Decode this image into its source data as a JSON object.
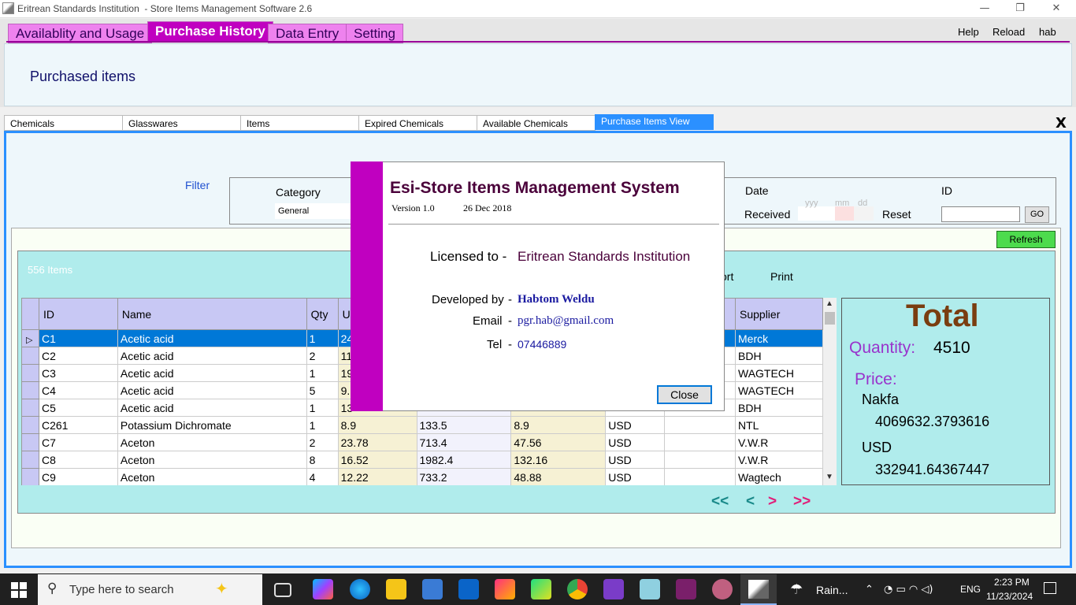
{
  "window": {
    "title": "Eritrean Standards Institution  - Store Items Management Software 2.6",
    "min": "—",
    "restore": "❐",
    "close": "✕"
  },
  "menu": {
    "tabs": [
      "Availablity and Usage",
      "Purchase History",
      "Data Entry",
      "Setting"
    ],
    "help": "Help",
    "reload": "Reload",
    "user": "hab"
  },
  "page_title": "Purchased items",
  "subtabs": [
    "Chemicals",
    "Glasswares",
    "Items",
    "Expired Chemicals",
    "Available Chemicals",
    "Purchase Items View"
  ],
  "close_x": "X",
  "filter": {
    "label": "Filter",
    "category_label": "Category",
    "category_value": "General",
    "date_label": "Date",
    "received_label": "Received",
    "date_hint_y": "yyy",
    "date_hint_m": "mm",
    "date_hint_d": "dd",
    "reset_label": "Reset",
    "id_label": "ID",
    "id_value": "",
    "go": "GO"
  },
  "refresh": "Refresh",
  "item_count": "556 Items",
  "report": "ort",
  "print": "Print",
  "grid": {
    "columns": [
      "ID",
      "Name",
      "Qty",
      "U",
      "",
      "",
      "",
      "",
      "Supplier"
    ],
    "rows": [
      [
        "C1",
        "Acetic acid",
        "1",
        "24",
        "",
        "",
        "",
        "",
        "Merck"
      ],
      [
        "C2",
        "Acetic acid",
        "2",
        "11",
        "",
        "",
        "",
        "",
        "BDH"
      ],
      [
        "C3",
        "Acetic acid",
        "1",
        "19",
        "",
        "",
        "",
        "",
        "WAGTECH"
      ],
      [
        "C4",
        "Acetic acid",
        "5",
        "9.",
        "",
        "",
        "",
        "",
        "WAGTECH"
      ],
      [
        "C5",
        "Acetic acid",
        "1",
        "13",
        "",
        "",
        "",
        "",
        "BDH"
      ],
      [
        "C261",
        "Potassium Dichromate",
        "1",
        "8.9",
        "133.5",
        "8.9",
        "USD",
        "",
        "NTL"
      ],
      [
        "C7",
        "Aceton",
        "2",
        "23.78",
        "713.4",
        "47.56",
        "USD",
        "",
        "V.W.R"
      ],
      [
        "C8",
        "Aceton",
        "8",
        "16.52",
        "1982.4",
        "132.16",
        "USD",
        "",
        "V.W.R"
      ],
      [
        "C9",
        "Aceton",
        "4",
        "12.22",
        "733.2",
        "48.88",
        "USD",
        "",
        "Wagtech"
      ]
    ]
  },
  "total": {
    "title": "Total",
    "quantity_label": "Quantity:",
    "quantity": "4510",
    "price_label": "Price:",
    "nakfa_label": "Nakfa",
    "nakfa": "4069632.3793616",
    "usd_label": "USD",
    "usd": "332941.64367447"
  },
  "pager": {
    "first": "<<",
    "prev": "<",
    "next": ">",
    "last": ">>"
  },
  "dialog": {
    "title": "Esi-Store Items Management System",
    "version": "Version 1.0",
    "date": "26 Dec 2018",
    "licensed_label": "Licensed to -",
    "licensed_value": "Eritrean Standards Institution",
    "dev_label": "Developed by",
    "dev_value": "Habtom Weldu",
    "email_label": "Email",
    "email_value": "pgr.hab@gmail.com",
    "tel_label": "Tel",
    "tel_value": "07446889",
    "dash": "-",
    "close": "Close"
  },
  "taskbar": {
    "search_placeholder": "Type here to search",
    "weather": "Rain...",
    "lang": "ENG",
    "time": "2:23 PM",
    "date": "11/23/2024"
  },
  "colors": {
    "accent": "#c000c0",
    "selection": "#0078d7",
    "teal": "#b0ecec",
    "refresh": "#4ddb4d"
  }
}
